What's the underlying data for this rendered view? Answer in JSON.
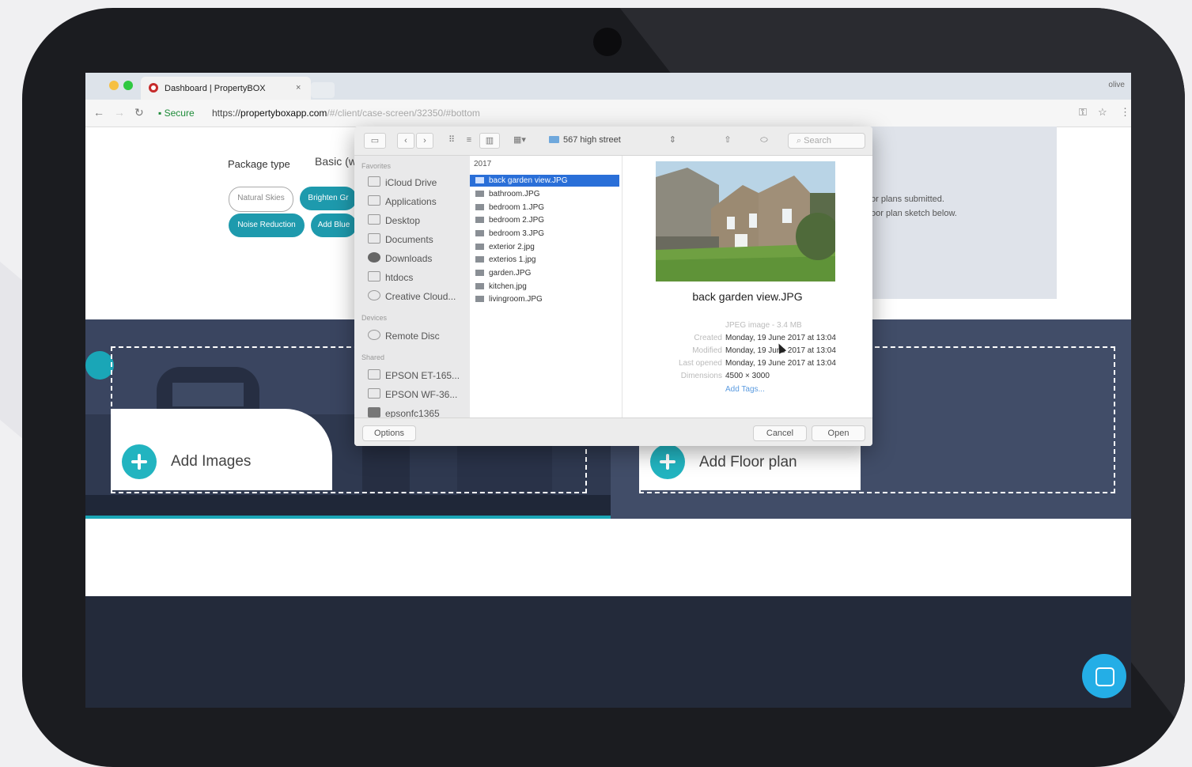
{
  "browser": {
    "tab_title": "Dashboard | PropertyBOX",
    "tab_close": "×",
    "profile_name": "olive",
    "secure_label": "Secure",
    "url_scheme": "https://",
    "url_host": "propertyboxapp.com",
    "url_path": "/#/client/case-screen/32350/#bottom"
  },
  "page": {
    "package_type_label": "Package type",
    "package_tab": "Basic (w",
    "options": [
      "Natural Skies",
      "Brighten Gr",
      "Noise Reduction",
      "Add Blue"
    ],
    "right_note_line1": "or plans submitted.",
    "right_note_line2": "oor plan sketch below.",
    "add_images": "Add Images",
    "add_floor_plan": "Add Floor plan"
  },
  "dialog": {
    "path": "567 high street",
    "search_placeholder": "Search",
    "favorites_heading": "Favorites",
    "favorites": [
      "iCloud Drive",
      "Applications",
      "Desktop",
      "Documents",
      "Downloads",
      "htdocs",
      "Creative Cloud..."
    ],
    "devices_heading": "Devices",
    "devices": [
      "Remote Disc"
    ],
    "shared_heading": "Shared",
    "shared": [
      "EPSON ET-165...",
      "EPSON WF-36...",
      "epsonfc1365"
    ],
    "column_header": "2017",
    "files": [
      "back garden view.JPG",
      "bathroom.JPG",
      "bedroom 1.JPG",
      "bedroom 2.JPG",
      "bedroom 3.JPG",
      "exterior 2.jpg",
      "exterios 1.jpg",
      "garden.JPG",
      "kitchen.jpg",
      "livingroom.JPG"
    ],
    "selected_file": "back garden view.JPG",
    "preview": {
      "name": "back garden view.JPG",
      "kind": "JPEG image - 3.4 MB",
      "created_label": "Created",
      "created": "Monday, 19 June 2017 at 13:04",
      "modified_label": "Modified",
      "modified": "Monday, 19 June 2017 at 13:04",
      "opened_label": "Last opened",
      "opened": "Monday, 19 June 2017 at 13:04",
      "dimensions_label": "Dimensions",
      "dimensions": "4500 × 3000",
      "add_tags": "Add Tags..."
    },
    "options_button": "Options",
    "cancel_button": "Cancel",
    "open_button": "Open"
  },
  "colors": {
    "accent": "#22b4c0",
    "hero": "#3a4560",
    "footer": "#232a3a",
    "selection": "#2a6fd8",
    "chat": "#24aee6"
  },
  "icons": [
    "back-arrow-icon",
    "forward-arrow-icon",
    "reload-icon",
    "lock-icon",
    "key-icon",
    "star-icon",
    "menu-icon",
    "sidebar-toggle-icon",
    "icon-view-icon",
    "list-view-icon",
    "column-view-icon",
    "gallery-view-icon",
    "share-icon",
    "tag-icon",
    "search-icon",
    "plus-icon",
    "chat-icon"
  ]
}
